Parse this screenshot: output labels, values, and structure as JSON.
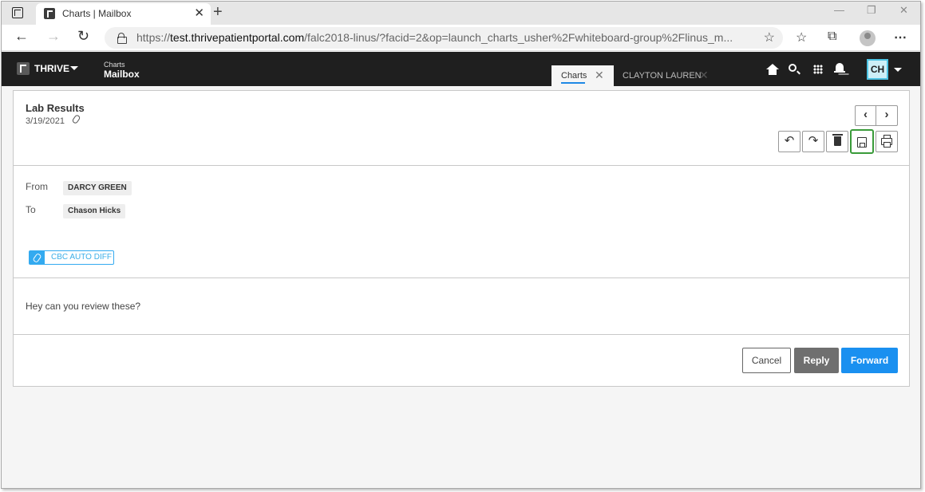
{
  "browser": {
    "tab_title": "Charts | Mailbox",
    "tab_close": "✕",
    "new_tab": "+",
    "url_prefix": "https://",
    "url_host": "test.thrivepatientportal.com",
    "url_path": "/falc2018-linus/?facid=2&op=launch_charts_usher%2Fwhiteboard-group%2Flinus_m...",
    "window_controls": [
      "—",
      "❐",
      "✕"
    ]
  },
  "app": {
    "brand": "THRIVE",
    "breadcrumb_parent": "Charts",
    "breadcrumb_current": "Mailbox",
    "tabs": [
      {
        "label": "Charts",
        "close": "✕"
      },
      {
        "label": "CLAYTON LAUREN",
        "close": "✕"
      }
    ],
    "user_initials": "CH",
    "icons": [
      "home-icon",
      "search-icon",
      "apps-grid-icon",
      "bell-icon"
    ]
  },
  "message": {
    "subject": "Lab Results",
    "date": "3/19/2021",
    "from_label": "From",
    "from_value": "DARCY GREEN",
    "to_label": "To",
    "to_value": "Chason Hicks",
    "attachment": "CBC AUTO DIFF",
    "body": "Hey can you review these?",
    "toolbar": {
      "prev": "‹",
      "next": "›",
      "reply_icon": "↶",
      "forward_icon": "↷"
    },
    "actions": {
      "cancel": "Cancel",
      "reply": "Reply",
      "forward": "Forward"
    }
  },
  "colors": {
    "header_bg": "#1f1f1f",
    "accent_blue": "#1a90f0",
    "save_highlight": "#3a9b3a",
    "reply_gray": "#6f6f6f"
  }
}
